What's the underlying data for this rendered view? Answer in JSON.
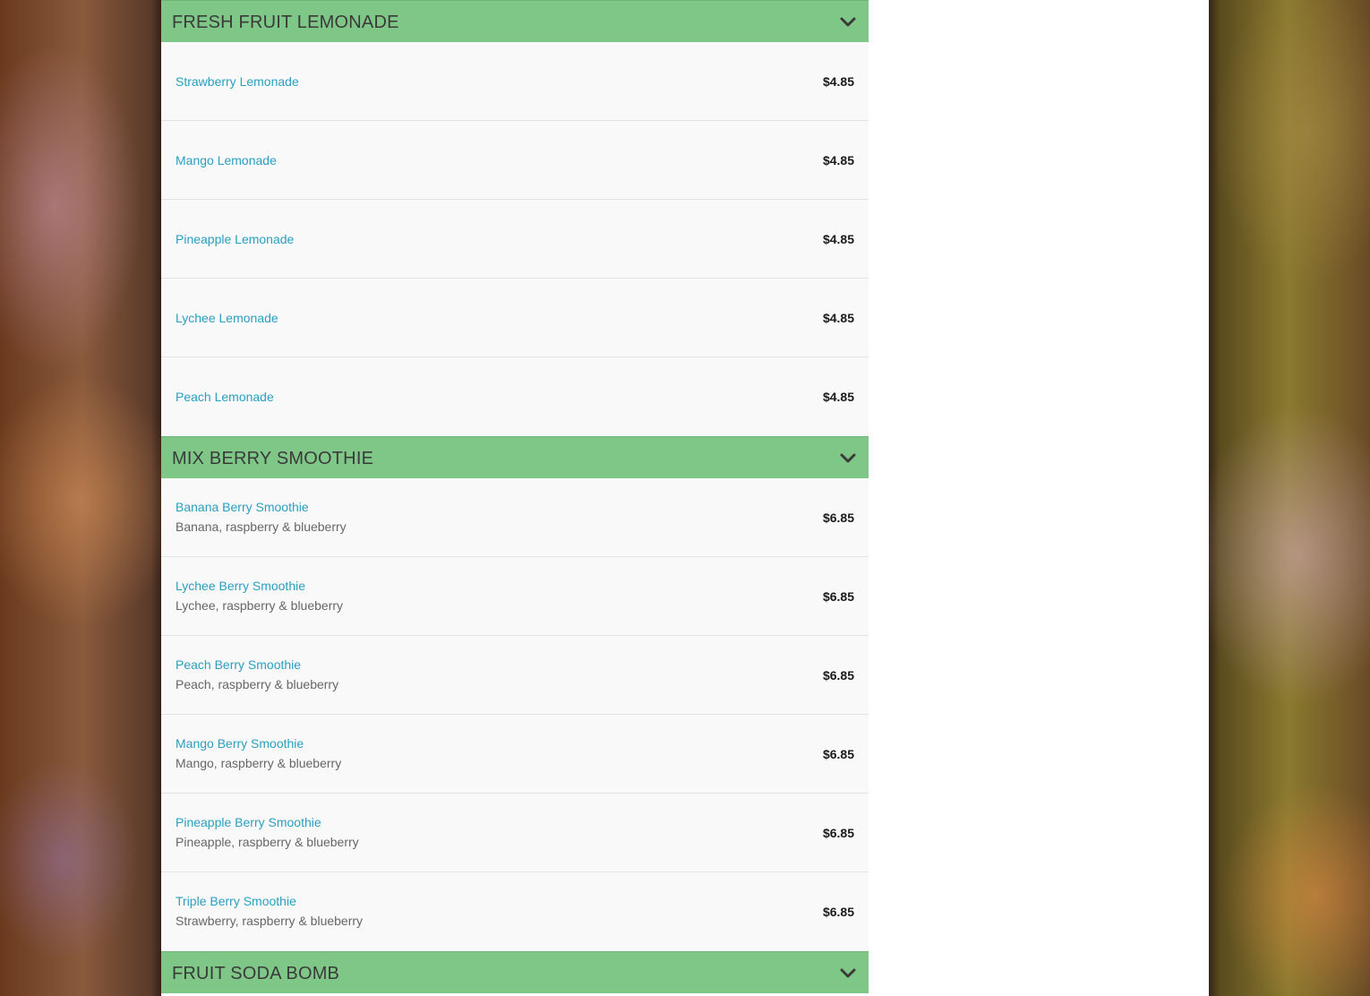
{
  "sections": [
    {
      "title": "FRESH FRUIT LEMONADE",
      "items": [
        {
          "name": "Strawberry Lemonade",
          "price": "$4.85"
        },
        {
          "name": "Mango Lemonade",
          "price": "$4.85"
        },
        {
          "name": "Pineapple Lemonade",
          "price": "$4.85"
        },
        {
          "name": "Lychee Lemonade",
          "price": "$4.85"
        },
        {
          "name": "Peach Lemonade",
          "price": "$4.85"
        }
      ]
    },
    {
      "title": "MIX BERRY SMOOTHIE",
      "items": [
        {
          "name": "Banana Berry Smoothie",
          "description": "Banana, raspberry & blueberry",
          "price": "$6.85"
        },
        {
          "name": "Lychee Berry Smoothie",
          "description": "Lychee, raspberry & blueberry",
          "price": "$6.85"
        },
        {
          "name": "Peach Berry Smoothie",
          "description": "Peach, raspberry & blueberry",
          "price": "$6.85"
        },
        {
          "name": "Mango Berry Smoothie",
          "description": "Mango, raspberry & blueberry",
          "price": "$6.85"
        },
        {
          "name": "Pineapple Berry Smoothie",
          "description": "Pineapple, raspberry & blueberry",
          "price": "$6.85"
        },
        {
          "name": "Triple Berry Smoothie",
          "description": "Strawberry, raspberry & blueberry",
          "price": "$6.85"
        }
      ]
    },
    {
      "title": "FRUIT SODA BOMB",
      "items": []
    }
  ],
  "icons": {
    "section_toggle": "chevron-down-icon"
  },
  "colors": {
    "section_header": "#7fc787",
    "item_name": "#2a9fc0",
    "item_desc": "#666666",
    "price": "#1a1a1a"
  }
}
